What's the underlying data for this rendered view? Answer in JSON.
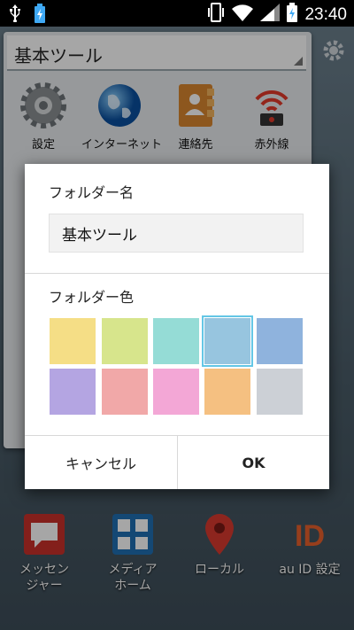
{
  "statusbar": {
    "time": "23:40",
    "icons": [
      "usb-icon",
      "battery-notify-icon",
      "vibrate-icon",
      "wifi-icon",
      "signal-icon",
      "battery-charging-icon"
    ]
  },
  "folder": {
    "title": "基本ツール",
    "apps": [
      {
        "label": "設定",
        "icon": "gear-icon"
      },
      {
        "label": "インターネット",
        "icon": "globe-icon"
      },
      {
        "label": "連絡先",
        "icon": "contacts-book-icon"
      },
      {
        "label": "赤外線",
        "icon": "infrared-icon"
      }
    ]
  },
  "dock": [
    {
      "label": "メッセン\nジャー",
      "icon": "message-icon"
    },
    {
      "label": "メディア\nホーム",
      "icon": "media-home-icon"
    },
    {
      "label": "ローカル",
      "icon": "map-pin-icon"
    },
    {
      "label": "au ID 設定",
      "icon": "au-id-icon"
    }
  ],
  "dialog": {
    "name_label": "フォルダー名",
    "name_value": "基本ツール",
    "color_label": "フォルダー色",
    "colors": [
      "#f5de86",
      "#d7e58c",
      "#95dcd6",
      "#97c5df",
      "#8fb3dd",
      "#b4a5e2",
      "#f1a8a8",
      "#f3a7d6",
      "#f5c081",
      "#ccd0d6"
    ],
    "selected_color_index": 3,
    "cancel_label": "キャンセル",
    "ok_label": "OK"
  }
}
